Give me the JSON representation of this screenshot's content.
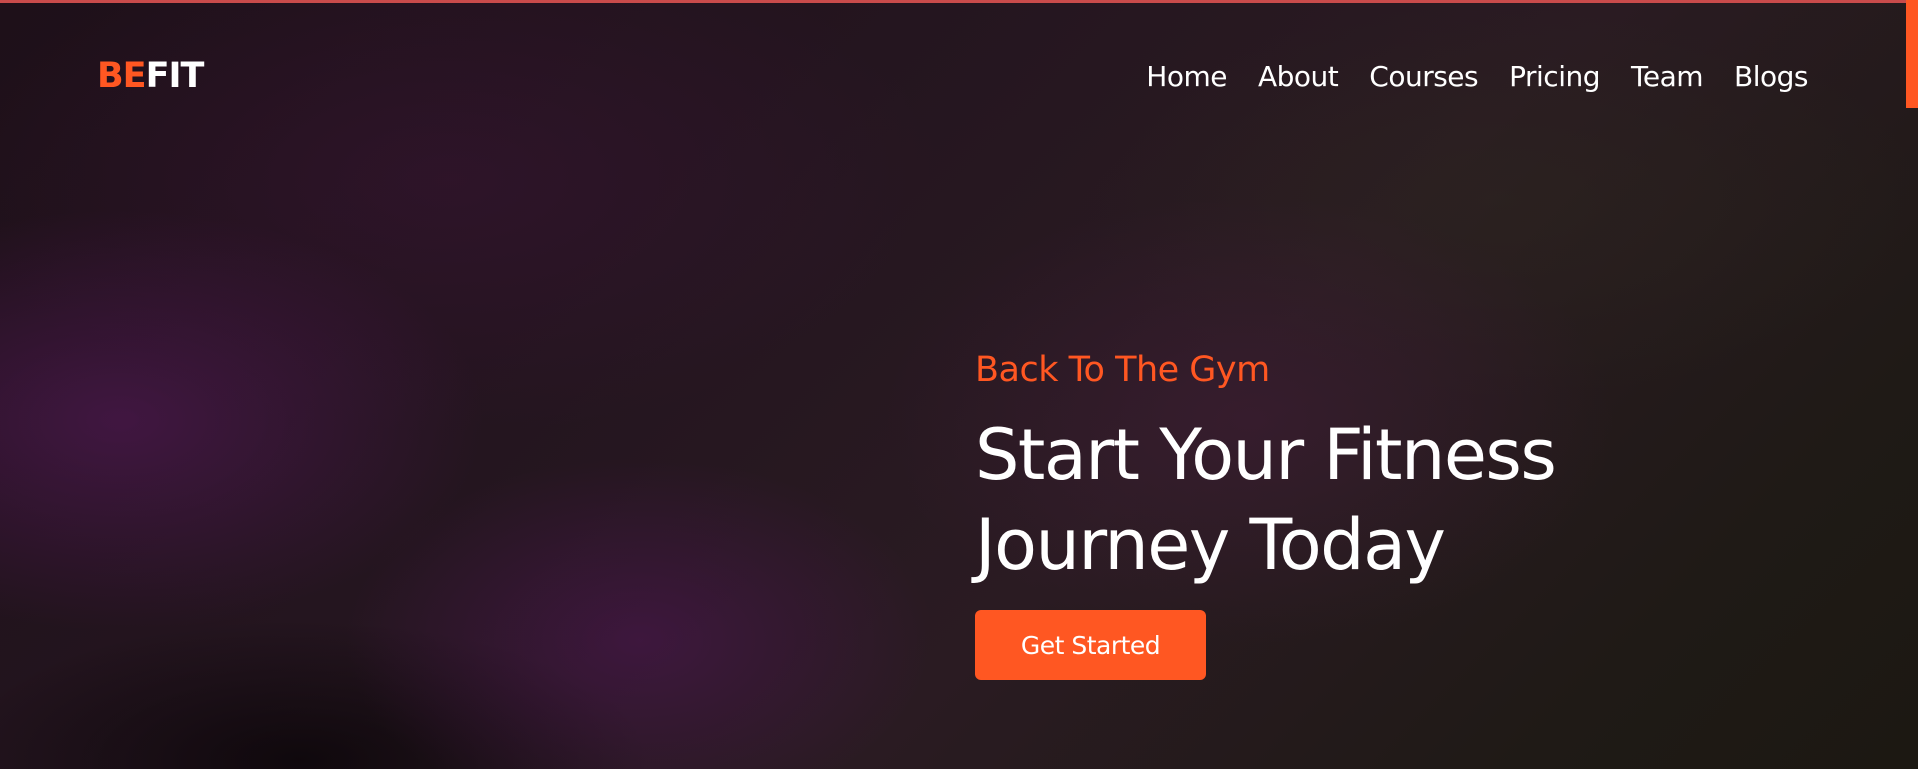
{
  "brand": {
    "logo_part1": "BE",
    "logo_part2": "FIT",
    "accent_color": "#ff5722"
  },
  "nav": {
    "items": [
      {
        "label": "Home"
      },
      {
        "label": "About"
      },
      {
        "label": "Courses"
      },
      {
        "label": "Pricing"
      },
      {
        "label": "Team"
      },
      {
        "label": "Blogs"
      }
    ]
  },
  "hero": {
    "subtitle": "Back To The Gym",
    "title_line1": "Start Your Fitness",
    "title_line2": "Journey Today",
    "cta_label": "Get Started"
  }
}
